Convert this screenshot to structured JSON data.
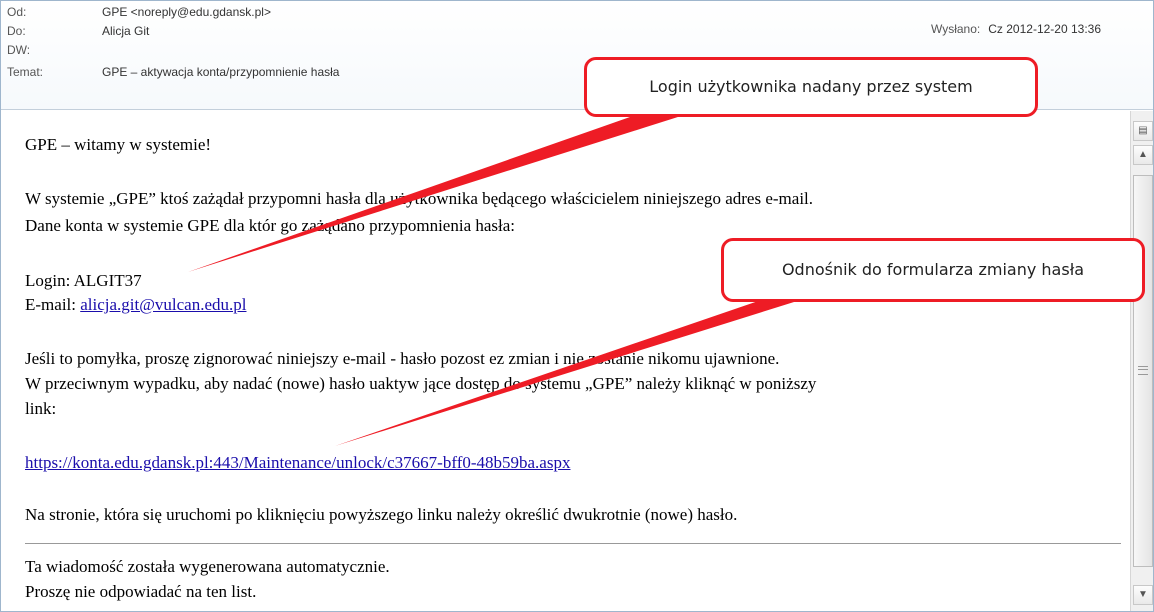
{
  "header": {
    "from_label": "Od:",
    "from_value": "GPE <noreply@edu.gdansk.pl>",
    "to_label": "Do:",
    "to_value": "Alicja Git",
    "cc_label": "DW:",
    "cc_value": "",
    "subject_label": "Temat:",
    "subject_value": "GPE – aktywacja konta/przypomnienie hasła",
    "sent_label": "Wysłano:",
    "sent_value": "Cz 2012-12-20 13:36"
  },
  "body": {
    "greeting": "GPE – witamy w systemie!",
    "para1_line1": "W systemie „GPE” ktoś zażądał przypomni   hasła dla użytkownika będącego właścicielem niniejszego adres e-mail.",
    "para1_line2": "Dane konta w systemie GPE dla któr   go zażądano przypomnienia hasła:",
    "login_line": "Login: ALGIT37",
    "email_label": "E-mail: ",
    "email_value": "alicja.git@vulcan.edu.pl",
    "para2_line1": "Jeśli to pomyłka, proszę zignorować niniejszy e-mail - hasło pozost       ez zmian i nie zostanie nikomu ujawnione.",
    "para2_line2": "W przeciwnym wypadku, aby nadać (nowe) hasło uaktyw        jące dostęp do systemu „GPE” należy kliknąć w poniższy",
    "para2_line3": "link:",
    "reset_link": "https://konta.edu.gdansk.pl:443/Maintenance/unlock/c37667-bff0-48b59ba.aspx",
    "para3": "Na stronie, która się uruchomi po kliknięciu powyższego linku należy określić dwukrotnie (nowe) hasło.",
    "footer_line1": "Ta wiadomość została wygenerowana automatycznie.",
    "footer_line2": "Proszę nie odpowiadać na ten list."
  },
  "callouts": {
    "login_note": "Login użytkownika nadany przez system",
    "link_note": "Odnośnik do formularza zmiany hasła"
  },
  "colors": {
    "callout_border": "#ee1c25",
    "link": "#1a0dab"
  }
}
